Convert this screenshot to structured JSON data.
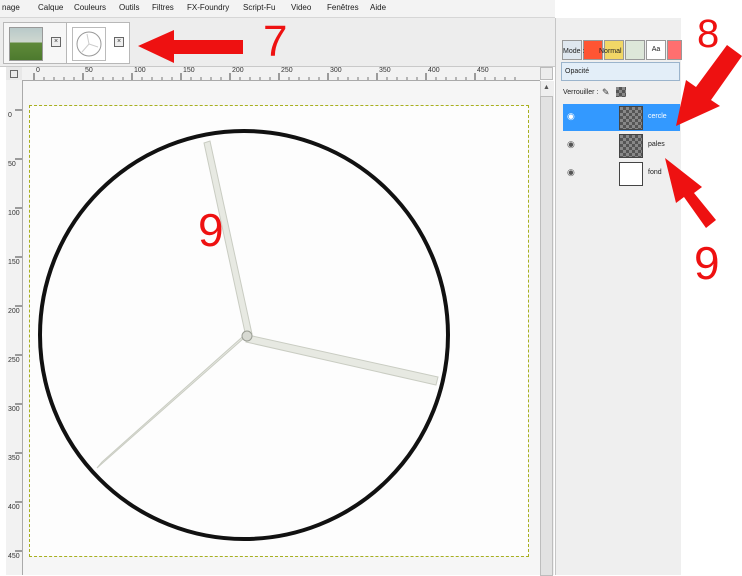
{
  "menubar": {
    "items": [
      "nage",
      "Calque",
      "Couleurs",
      "Outils",
      "Filtres",
      "FX-Foundry",
      "Script-Fu",
      "Video",
      "Fenêtres",
      "Aide"
    ]
  },
  "panel": {
    "mode_label": "Mode :",
    "mode_value": "Normal",
    "opacity_label": "Opacité",
    "lock_label": "Verrouiller :"
  },
  "layers": [
    {
      "name": "cercle",
      "selected": true
    },
    {
      "name": "pales",
      "selected": false
    },
    {
      "name": "fond",
      "selected": false
    }
  ],
  "ruler": {
    "h_labels": [
      "0",
      "50",
      "100",
      "150",
      "200",
      "250",
      "300",
      "350",
      "400",
      "450"
    ],
    "v_labels": [
      "0",
      "50",
      "100",
      "150",
      "200",
      "250",
      "300",
      "350",
      "400",
      "450"
    ]
  },
  "annotations": {
    "tab_number": "7",
    "layer_number": "8",
    "canvas_number": "9",
    "panel_number": "9"
  },
  "colors": {
    "annotation": "#ee1111",
    "layer_selected": "#3399ff",
    "selection_border": "#a8b020"
  }
}
